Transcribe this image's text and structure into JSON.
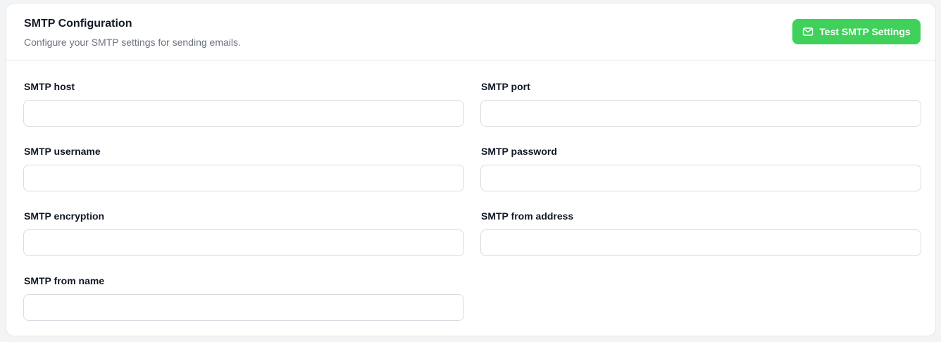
{
  "header": {
    "title": "SMTP Configuration",
    "subtitle": "Configure your SMTP settings for sending emails.",
    "test_button_label": "Test SMTP Settings",
    "test_button_icon": "envelope-icon",
    "accent_color": "#3fd15a"
  },
  "fields": {
    "host": {
      "label": "SMTP host",
      "value": ""
    },
    "port": {
      "label": "SMTP port",
      "value": ""
    },
    "username": {
      "label": "SMTP username",
      "value": ""
    },
    "password": {
      "label": "SMTP password",
      "value": ""
    },
    "encryption": {
      "label": "SMTP encryption",
      "value": ""
    },
    "from_address": {
      "label": "SMTP from address",
      "value": ""
    },
    "from_name": {
      "label": "SMTP from name",
      "value": ""
    }
  }
}
